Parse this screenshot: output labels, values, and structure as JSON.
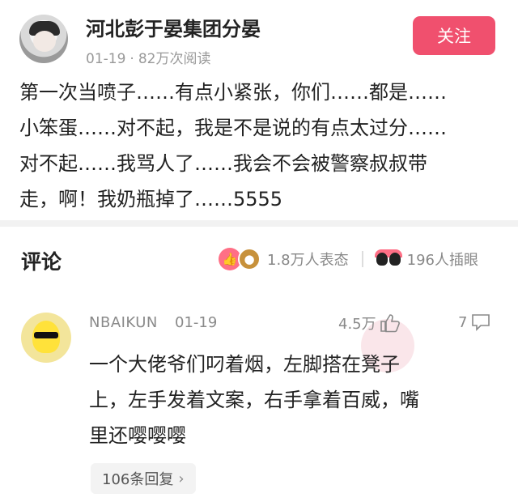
{
  "post": {
    "author": "河北彭于晏集团分晏",
    "date": "01-19",
    "views": "82万次阅读",
    "follow_label": "关注",
    "body_lines": [
      "第一次当喷子……有点小紧张，你们……都是……",
      "小笨蛋……对不起，我是不是说的有点太过分……",
      "对不起……我骂人了……我会不会被警察叔叔带",
      "走，啊！我奶瓶掉了……5555"
    ]
  },
  "comments_section": {
    "title": "评论",
    "reactions_count": "1.8万人表态",
    "eyes_count": "196人插眼"
  },
  "comment": {
    "name": "NBAIKUN",
    "date": "01-19",
    "likes": "4.5万",
    "replies": "7",
    "text_lines": [
      "一个大佬爷们叼着烟，左脚搭在凳子",
      "上，左手发着文案，右手拿着百威，嘴",
      "里还嘤嘤嘤"
    ],
    "reply_count_label": "106条回复"
  },
  "icons": {
    "reaction_like": "like-reaction-icon",
    "reaction_poop": "poop-reaction-icon",
    "eyes": "eyes-icon",
    "thumb": "thumbs-up-icon",
    "reply": "comment-bubble-icon",
    "chevron": "chevron-right-icon"
  },
  "colors": {
    "follow_button": "#f0506e",
    "meta_text": "#999999"
  }
}
